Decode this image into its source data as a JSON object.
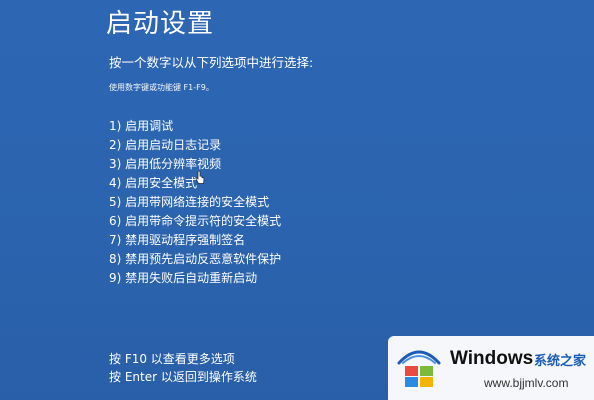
{
  "screen": {
    "title": "启动设置",
    "instruction": "按一个数字以从下列选项中进行选择:",
    "hint": "使用数字键或功能键 F1-F9。",
    "options": [
      "1) 启用调试",
      "2) 启用启动日志记录",
      "3) 启用低分辨率视频",
      "4) 启用安全模式",
      "5) 启用带网络连接的安全模式",
      "6) 启用带命令提示符的安全模式",
      "7) 禁用驱动程序强制签名",
      "8) 禁用预先启动反恶意软件保护",
      "9) 禁用失败后自动重新启动"
    ],
    "footer": {
      "more_options": "按 F10 以查看更多选项",
      "return_os": "按 Enter 以返回到操作系统"
    }
  },
  "watermark": {
    "brand": "Windows",
    "cn": "系统之家",
    "url": "www.bjjmlv.com",
    "logo_icon": "windows-logo-icon"
  },
  "colors": {
    "background": "#2c66b2",
    "text": "#ffffff"
  }
}
